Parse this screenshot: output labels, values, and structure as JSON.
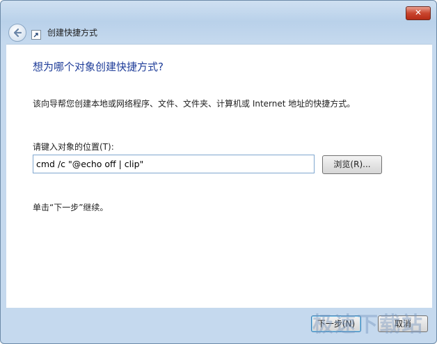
{
  "window": {
    "close_label": "✕",
    "title": "创建快捷方式"
  },
  "content": {
    "heading": "想为哪个对象创建快捷方式?",
    "description": "该向导帮您创建本地或网络程序、文件、文件夹、计算机或 Internet 地址的快捷方式。",
    "location_label": "请键入对象的位置(T):",
    "location_value": "cmd /c \"@echo off | clip\"",
    "browse_label": "浏览(R)...",
    "hint": "单击“下一步”继续。"
  },
  "footer": {
    "next_label": "下一步(N)",
    "cancel_label": "取消"
  },
  "watermark": "极速下载站"
}
